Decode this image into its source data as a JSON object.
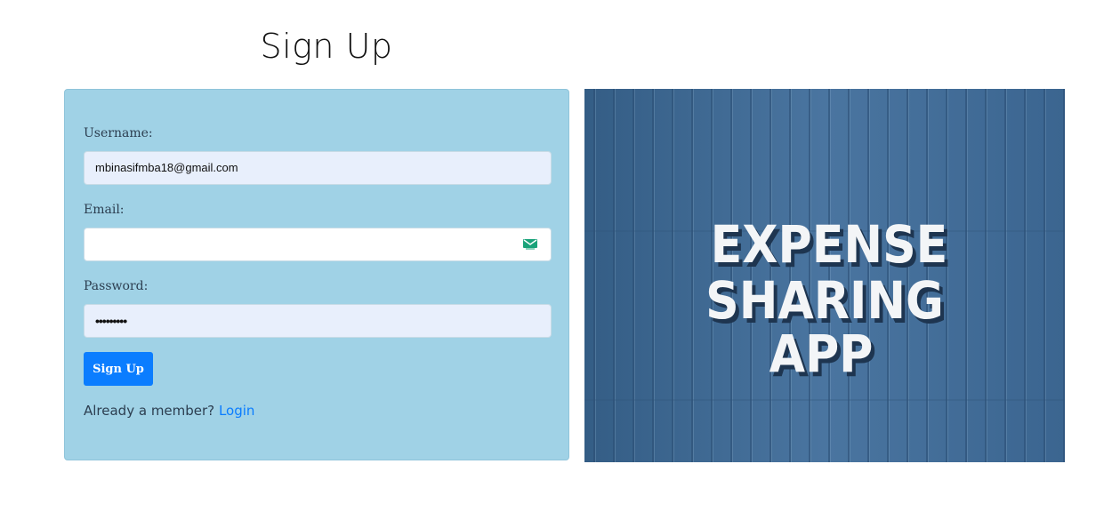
{
  "page": {
    "title": "Sign Up"
  },
  "form": {
    "username_label": "Username:",
    "username_value": "mbinasifmba18@gmail.com",
    "email_label": "Email:",
    "email_value": "",
    "email_icon": "envelope-icon",
    "password_label": "Password:",
    "password_value": "•••••••••",
    "submit_label": "Sign Up",
    "member_prompt": "Already a member?",
    "login_link": "Login"
  },
  "hero": {
    "line1": "EXPENSE",
    "line2": "SHARING",
    "line3": "APP"
  },
  "colors": {
    "card_bg": "#a0d2e6",
    "primary": "#0b7dff",
    "hero_bg": "#3f6890"
  }
}
